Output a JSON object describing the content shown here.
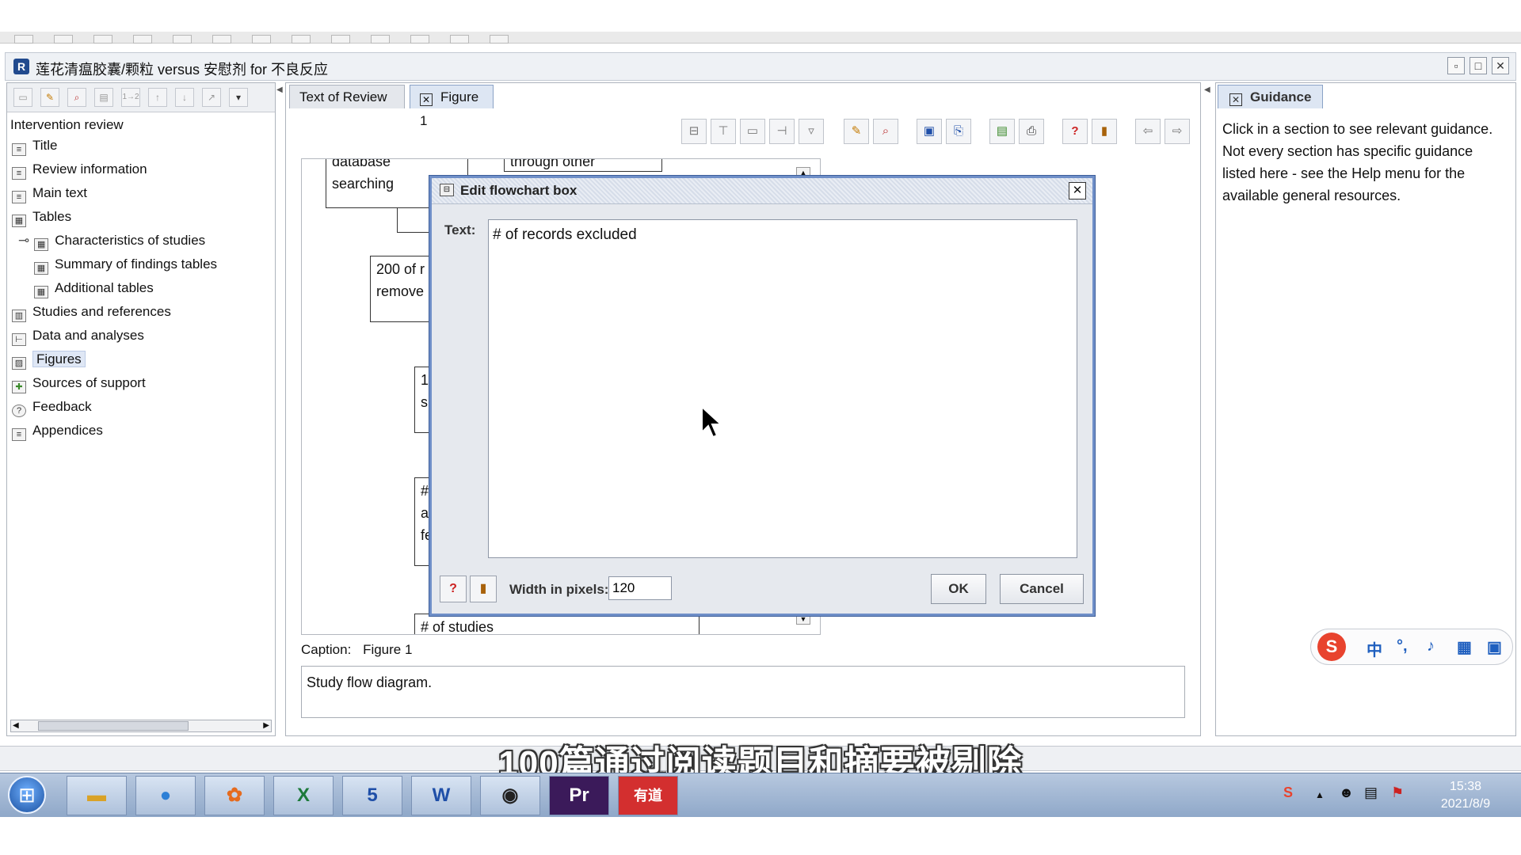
{
  "window": {
    "title": "莲花清瘟胶囊/颗粒 versus 安慰剂 for 不良反应",
    "app_icon": "R"
  },
  "sidebar": {
    "items": [
      {
        "label": "Intervention review",
        "icon": ""
      },
      {
        "label": "Title",
        "icon": "document-icon"
      },
      {
        "label": "Review information",
        "icon": "document-icon"
      },
      {
        "label": "Main text",
        "icon": "document-icon"
      },
      {
        "label": "Tables",
        "icon": "table-icon"
      },
      {
        "label": "Characteristics of studies",
        "icon": "table-icon"
      },
      {
        "label": "Summary of findings tables",
        "icon": "table-icon"
      },
      {
        "label": "Additional tables",
        "icon": "table-icon"
      },
      {
        "label": "Studies and references",
        "icon": "book-icon"
      },
      {
        "label": "Data and analyses",
        "icon": "analysis-icon"
      },
      {
        "label": "Figures",
        "icon": "image-icon"
      },
      {
        "label": "Sources of support",
        "icon": "support-icon"
      },
      {
        "label": "Feedback",
        "icon": "feedback-icon"
      },
      {
        "label": "Appendices",
        "icon": "document-icon"
      }
    ],
    "selected": "Figures"
  },
  "tabs": [
    {
      "label": "Text of Review"
    },
    {
      "label": "Figure 1"
    }
  ],
  "flowchart": {
    "box1": "searching",
    "box1_top_partial": "database",
    "box2_top_partial": "through other",
    "box3": "200 of r\nremove",
    "box4": "1\ns",
    "box5": "#\na\nfe",
    "box6": "# of studies"
  },
  "caption": {
    "label": "Caption:",
    "figure": "Figure 1",
    "text": "Study flow diagram."
  },
  "guidance": {
    "tab": "Guidance",
    "text": "Click in a section to see relevant guidance. Not every section has specific guidance listed here - see the Help menu for the available general resources."
  },
  "dialog": {
    "title": "Edit flowchart box",
    "text_label": "Text:",
    "text_value": "# of records excluded",
    "width_label": "Width in pixels:",
    "width_value": "120",
    "ok_label": "OK",
    "cancel_label": "Cancel"
  },
  "subtitle": "100篇通过阅读题目和摘要被剔除",
  "ime": {
    "lang": "中",
    "punct": "°,"
  },
  "taskbar": {
    "clock_time": "15:38",
    "clock_date": "2021/8/9",
    "apps": [
      "file-explorer-icon",
      "browser-icon",
      "pdf-icon",
      "excel-icon",
      "app-5-icon",
      "word-icon",
      "obs-icon",
      "premiere-icon",
      "youdao-icon"
    ],
    "app_labels": [
      "",
      "",
      "",
      "X",
      "5",
      "W",
      "",
      "Pr",
      "有道"
    ]
  }
}
